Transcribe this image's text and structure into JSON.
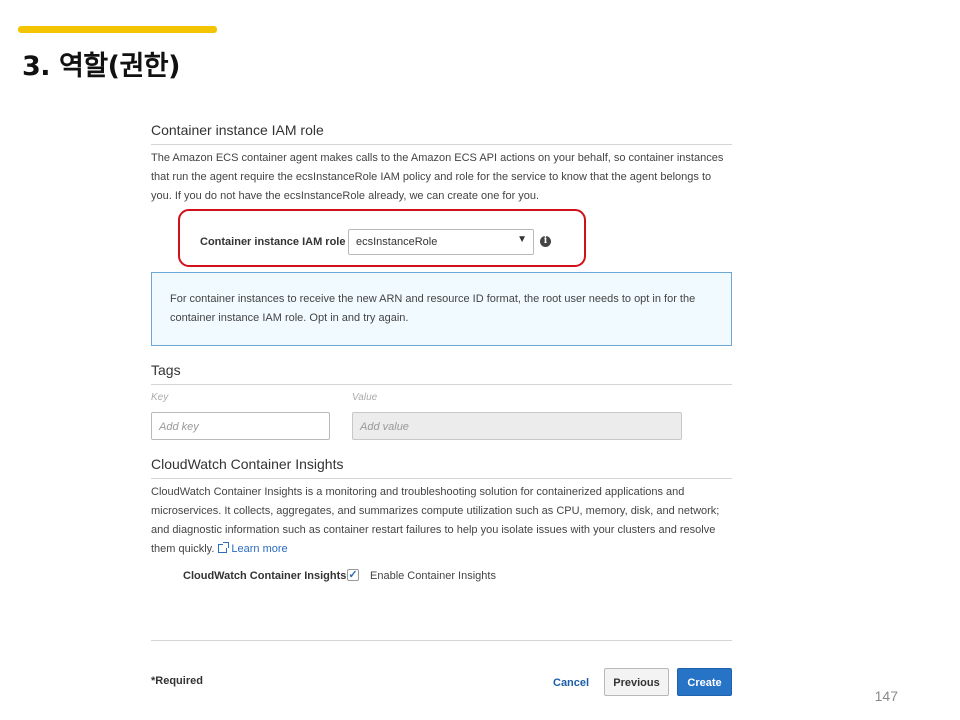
{
  "slide": {
    "title": "3. 역할(권한)",
    "page_number": "147",
    "accent_color": "#f5c400"
  },
  "iam_section": {
    "title": "Container instance IAM role",
    "description": "The Amazon ECS container agent makes calls to the Amazon ECS API actions on your behalf, so container instances that run the agent require the ecsInstanceRole IAM policy and role for the service to know that the agent belongs to you. If you do not have the ecsInstanceRole already, we can create one for you.",
    "field_label": "Container instance IAM role",
    "selected_value": "ecsInstanceRole",
    "info_icon": "i",
    "highlight_color": "#d0111b"
  },
  "info_box": {
    "message": "For container instances to receive the new ARN and resource ID format, the root user needs to opt in for the container instance IAM role. Opt in and try again."
  },
  "tags": {
    "title": "Tags",
    "key_label": "Key",
    "value_label": "Value",
    "key_placeholder": "Add key",
    "value_placeholder": "Add value"
  },
  "insights": {
    "title": "CloudWatch Container Insights",
    "description": "CloudWatch Container Insights is a monitoring and troubleshooting solution for containerized applications and microservices. It collects, aggregates, and summarizes compute utilization such as CPU, memory, disk, and network; and diagnostic information such as container restart failures to help you isolate issues with your clusters and resolve them quickly.",
    "learn_more": "Learn more",
    "field_label": "CloudWatch Container Insights",
    "checkbox_label": "Enable Container Insights",
    "checked": true
  },
  "footer": {
    "required": "*Required",
    "cancel": "Cancel",
    "previous": "Previous",
    "create": "Create",
    "primary_color": "#2773c6"
  }
}
